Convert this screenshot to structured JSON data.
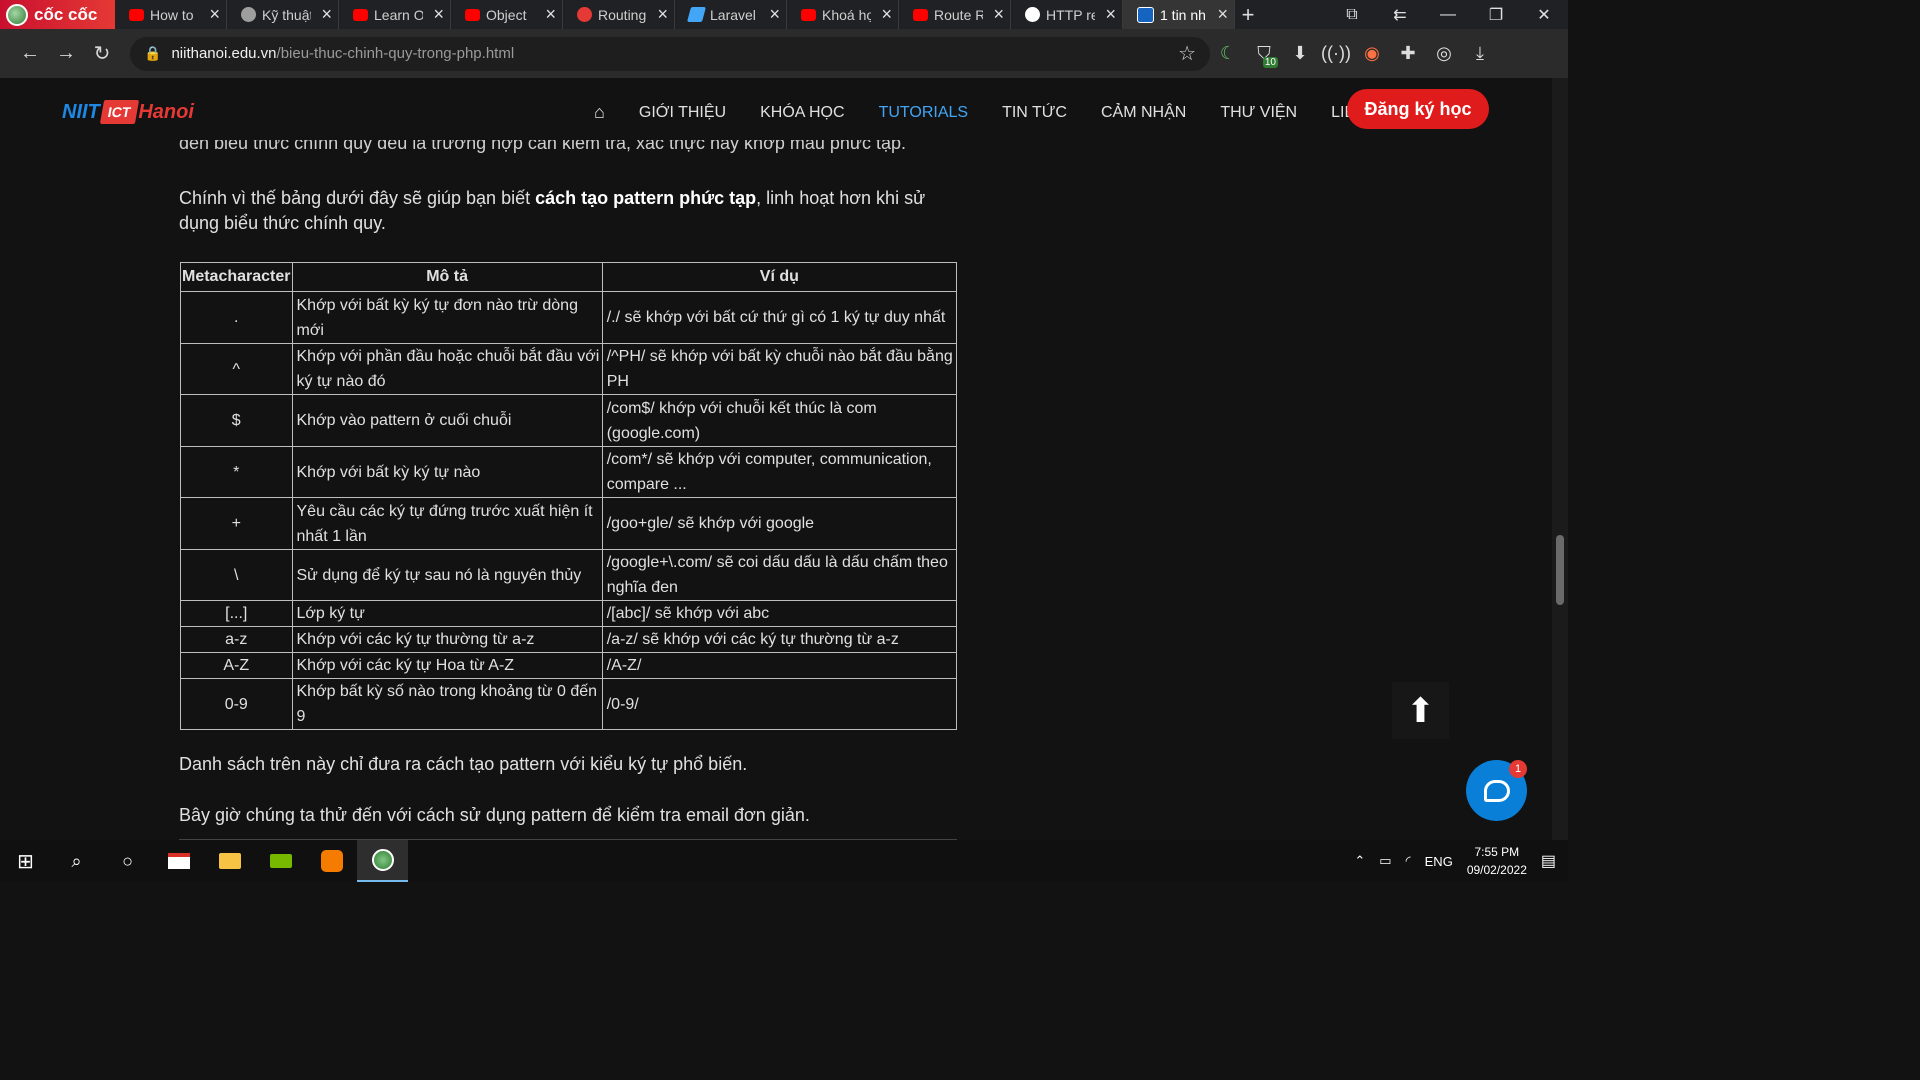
{
  "browser": {
    "brand": "cốc cốc",
    "tabs": [
      {
        "title": "How to",
        "icon": "youtube-icon"
      },
      {
        "title": "Kỹ thuật",
        "icon": "web-icon"
      },
      {
        "title": "Learn O",
        "icon": "youtube-icon"
      },
      {
        "title": "Object",
        "icon": "youtube-icon"
      },
      {
        "title": "Routing",
        "icon": "laravel-icon"
      },
      {
        "title": "Laravel",
        "icon": "feather-icon"
      },
      {
        "title": "Khoá họ",
        "icon": "youtube-icon"
      },
      {
        "title": "Route R",
        "icon": "youtube-icon"
      },
      {
        "title": "HTTP re",
        "icon": "web-icon"
      },
      {
        "title": "1 tin nh",
        "icon": "niit-icon"
      }
    ],
    "url_host": "niithanoi.edu.vn",
    "url_path": "/bieu-thuc-chinh-quy-trong-php.html",
    "ext_badge": "10"
  },
  "site": {
    "logo": {
      "niit": "NIIT",
      "ict": "ICT",
      "hanoi": "Hanoi"
    },
    "menu": [
      "GIỚI THIỆU",
      "KHÓA HỌC",
      "TUTORIALS",
      "TIN TỨC",
      "CẢM NHẬN",
      "THƯ VIỆN",
      "LIÊN HỆ"
    ],
    "active_menu": "TUTORIALS",
    "register": "Đăng ký học"
  },
  "article": {
    "clipped_text": "đến biểu thức chính quy đều là trường hợp cần kiểm tra, xác thực hay khớp mẫu phức tạp.",
    "intro_before": "Chính vì thế bảng dưới đây sẽ giúp bạn biết ",
    "intro_bold": "cách tạo pattern phức tạp",
    "intro_after": ", linh hoạt hơn khi sử dụng biểu thức chính quy.",
    "table": {
      "headers": [
        "Metacharacter",
        "Mô tả",
        "Ví dụ"
      ],
      "rows": [
        [
          ".",
          "Khớp với bất kỳ ký tự đơn nào trừ dòng mới",
          "/./ sẽ khớp với bất cứ thứ gì có 1 ký tự duy nhất"
        ],
        [
          "^",
          "Khớp với phần đầu hoặc chuỗi bắt đầu với ký tự nào đó",
          "/^PH/ sẽ khớp với bất kỳ chuỗi nào bắt đầu bằng PH"
        ],
        [
          "$",
          "Khớp vào pattern ở cuối chuỗi",
          "/com$/ khớp với chuỗi kết thúc là com (google.com)"
        ],
        [
          "*",
          "Khớp với bất kỳ ký tự nào",
          "/com*/ sẽ khớp với computer, communication, compare ..."
        ],
        [
          "+",
          "Yêu cầu các ký tự đứng trước xuất hiện ít nhất 1 lần",
          "/goo+gle/ sẽ khớp với google"
        ],
        [
          "\\",
          "Sử dụng để ký tự sau nó là nguyên thủy",
          "/google+\\.com/ sẽ coi dấu dấu là dấu chấm theo nghĩa đen"
        ],
        [
          "[...]",
          "Lớp ký tự",
          "/[abc]/ sẽ khớp với abc"
        ],
        [
          "a-z",
          "Khớp với các ký tự thường từ a-z",
          "/a-z/ sẽ khớp với các ký tự thường từ a-z"
        ],
        [
          "A-Z",
          "Khớp với các ký tự Hoa từ A-Z",
          "/A-Z/"
        ],
        [
          "0-9",
          "Khớp bất kỳ số nào trong khoảng từ 0 đến 9",
          "/0-9/"
        ]
      ]
    },
    "after_table": "Danh sách trên này chỉ đưa ra cách tạo pattern với kiểu ký tự phổ biến.",
    "next_para": "Bây giờ chúng ta thử đến với cách sử dụng pattern để kiểm tra email đơn giản."
  },
  "chat": {
    "unread": "1"
  },
  "taskbar": {
    "lang": "ENG",
    "time": "7:55 PM",
    "date": "09/02/2022"
  }
}
